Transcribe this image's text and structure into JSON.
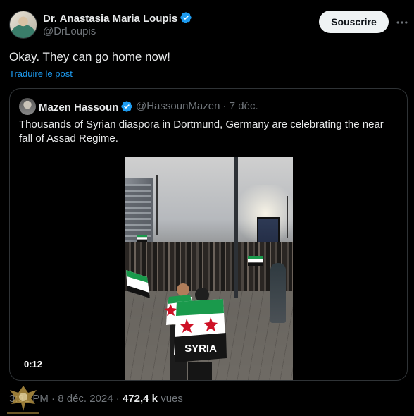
{
  "post": {
    "author_name": "Dr. Anastasia Maria Loupis",
    "author_handle": "@DrLoupis",
    "subscribe_label": "Souscrire",
    "text": "Okay. They can go home now!",
    "translate_label": "Traduire le post",
    "meta": {
      "time": "3:31 PM",
      "separator": "·",
      "date": "8 déc. 2024",
      "views_count": "472,4 k",
      "views_label": "vues"
    }
  },
  "quote": {
    "author_name": "Mazen Hassoun",
    "author_handle": "@HassounMazen",
    "age": "7 déc.",
    "text": "Thousands of Syrian diaspora in Dortmund, Germany are celebrating the near fall of Assad Regime.",
    "video_duration": "0:12",
    "banner_text": "SYRIA"
  },
  "colors": {
    "accent": "#1d9bf0",
    "verified": "#1d9bf0",
    "background": "#000000",
    "flag_green": "#1a9a4c",
    "flag_red": "#ce1126"
  },
  "icons": {
    "verified": "verified-badge-icon",
    "more": "more-dots-icon"
  }
}
